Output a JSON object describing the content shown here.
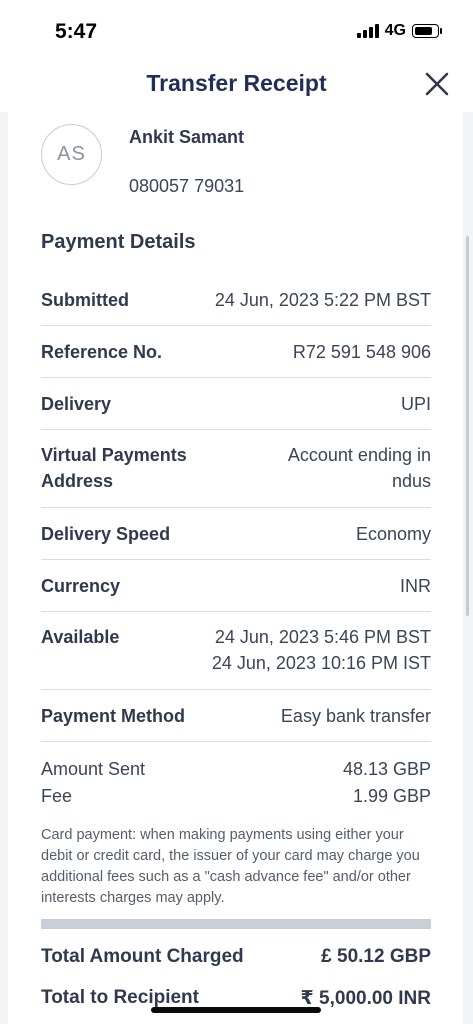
{
  "status_bar": {
    "time": "5:47",
    "network": "4G"
  },
  "header": {
    "title": "Transfer Receipt",
    "close_icon": "close-icon"
  },
  "recipient": {
    "initials": "AS",
    "name": "Ankit Samant",
    "account": "080057 79031"
  },
  "payment_details": {
    "title": "Payment Details",
    "rows": [
      {
        "label": "Submitted",
        "value": "24 Jun, 2023 5:22 PM BST"
      },
      {
        "label": "Reference No.",
        "value": "R72 591 548 906"
      },
      {
        "label": "Delivery",
        "value": "UPI"
      },
      {
        "label_line1": "Virtual Payments",
        "label_line2": "Address",
        "value_line1": "Account ending in",
        "value_line2": "ndus"
      },
      {
        "label": "Delivery Speed",
        "value": "Economy"
      },
      {
        "label": "Currency",
        "value": "INR"
      },
      {
        "label": "Available",
        "value_line1": "24 Jun, 2023 5:46 PM BST",
        "value_line2": "24 Jun, 2023 10:16 PM IST"
      },
      {
        "label": "Payment Method",
        "value": "Easy bank transfer"
      }
    ]
  },
  "amounts": {
    "sent_label": "Amount Sent",
    "sent_value": "48.13 GBP",
    "fee_label": "Fee",
    "fee_value": "1.99 GBP"
  },
  "note": "Card payment: when making payments using either your debit or credit card, the issuer of your card may charge you additional fees such as a \"cash advance fee\" and/or other interests charges may apply.",
  "totals": {
    "charged_label": "Total Amount Charged",
    "charged_value": "£ 50.12 GBP",
    "recipient_label": "Total to Recipient",
    "recipient_value": "₹ 5,000.00 INR"
  }
}
